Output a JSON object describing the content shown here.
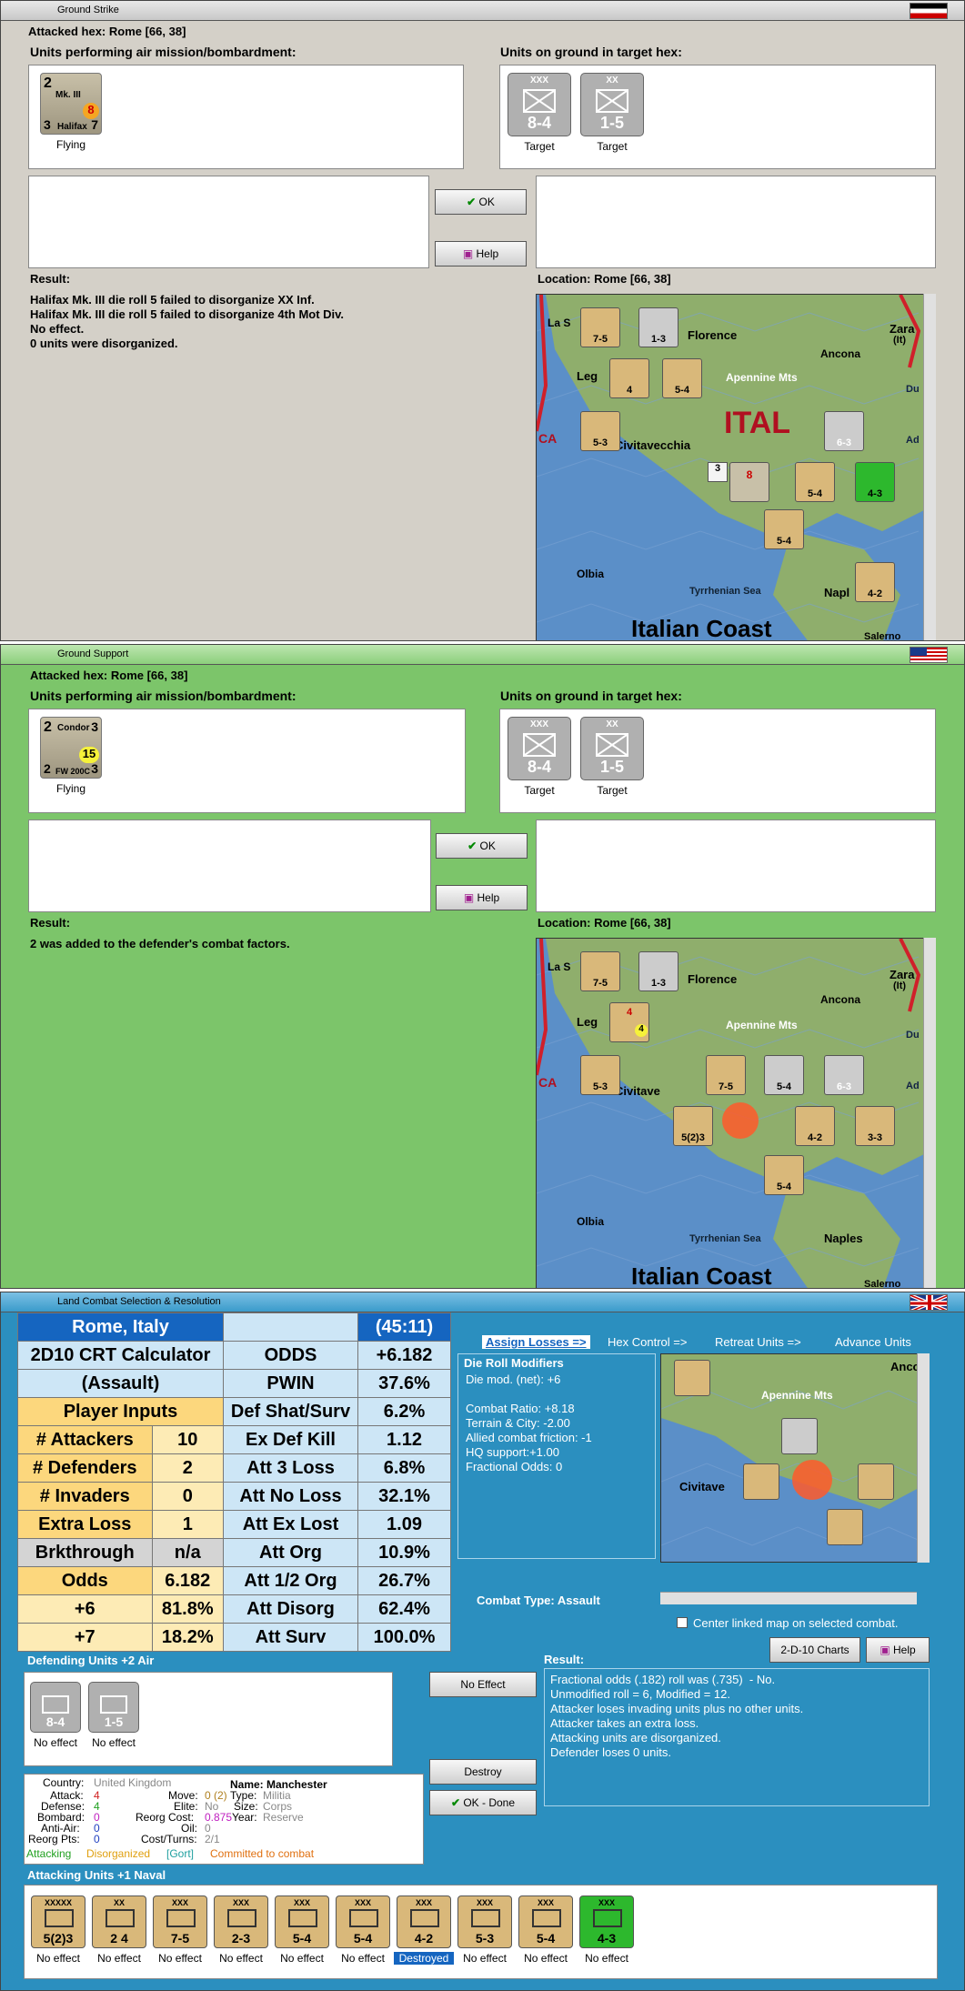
{
  "win1": {
    "title": "Ground Strike",
    "attacked": "Attacked hex: Rome  [66, 38]",
    "air_label": "Units performing air mission/bombardment:",
    "ground_label": "Units on ground in target hex:",
    "air_unit": {
      "top_left": "2",
      "top_right": "8",
      "name": "Mk. III",
      "sub": "Halifax",
      "bl": "3",
      "br": "7",
      "caption": "Flying"
    },
    "targets": [
      {
        "type": "XXX",
        "name": "XX Inf",
        "value": "8-4",
        "caption": "Target"
      },
      {
        "type": "XX",
        "name": "4th Mot Div",
        "value": "1-5",
        "caption": "Target"
      }
    ],
    "ok": "OK",
    "help": "Help",
    "result_label": "Result:",
    "location": "Location:  Rome  [66, 38]",
    "result": "Halifax Mk. III die roll 5 failed to disorganize XX Inf.\nHalifax Mk. III die roll 5 failed to disorganize 4th Mot Div.\nNo effect.\n0 units were disorganized.",
    "map_labels": [
      "La S",
      "Florence",
      "Ancona",
      "Zara",
      "(It)",
      "Leg",
      "Apennine Mts",
      "ITAL",
      "CA",
      "Civitavecchia",
      "Olbia",
      "Tyrrhenian Sea",
      "Napl",
      "Salerno",
      "Italian Coast",
      "Du",
      "Ad"
    ],
    "map_counters": [
      "7-5",
      "1-3",
      "4",
      "5-4",
      "5-3",
      "6-3",
      "5-4",
      "4-3",
      "5-4",
      "4-2",
      "8",
      "3"
    ]
  },
  "win2": {
    "title": "Ground Support",
    "attacked": "Attacked hex: Rome  [66, 38]",
    "air_label": "Units performing air mission/bombardment:",
    "ground_label": "Units on ground in target hex:",
    "air_unit": {
      "top_left": "2",
      "top_right": "3",
      "name": "Condor",
      "value": "15",
      "sub": "FW 200C",
      "bl": "2",
      "br": "3",
      "caption": "Flying"
    },
    "targets": [
      {
        "type": "XXX",
        "name": "XX Inf",
        "value": "8-4",
        "caption": "Target"
      },
      {
        "type": "XX",
        "name": "4th Mot Div",
        "value": "1-5",
        "caption": "Target"
      }
    ],
    "ok": "OK",
    "help": "Help",
    "result_label": "Result:",
    "location": "Location:  Rome  [66, 38]",
    "result": "2 was added to the defender's combat factors.",
    "map_labels": [
      "La S",
      "Florence",
      "Ancona",
      "Zara",
      "(It)",
      "Leg",
      "Apennine Mts",
      "CA",
      "Civitave",
      "Olbia",
      "Tyrrhenian Sea",
      "Naples",
      "Salerno",
      "Italian Coast",
      "Du",
      "Ad"
    ],
    "map_counters": [
      "7-5",
      "1-3",
      "5-3",
      "7-5",
      "5-4",
      "6-3",
      "5(2)3",
      "4-2",
      "3-3",
      "5-4",
      "4",
      "4"
    ]
  },
  "win3": {
    "title": "Land Combat Selection & Resolution",
    "crt": {
      "location": "Rome, Italy",
      "time": "(45:11)",
      "calc1": "2D10 CRT Calculator",
      "calc2": "(Assault)",
      "player_inputs": "Player Inputs",
      "rows": [
        {
          "l": "ODDS",
          "r": "+6.182"
        },
        {
          "l": "PWIN",
          "r": "37.6%"
        },
        {
          "l": "Def Shat/Surv",
          "r": "6.2%"
        },
        {
          "l": "Ex Def Kill",
          "r": "1.12"
        },
        {
          "l": "Att 3 Loss",
          "r": "6.8%"
        },
        {
          "l": "Att No Loss",
          "r": "32.1%"
        },
        {
          "l": "Att Ex Lost",
          "r": "1.09"
        },
        {
          "l": "Att Org",
          "r": "10.9%"
        },
        {
          "l": "Att 1/2 Org",
          "r": "26.7%"
        },
        {
          "l": "Att Disorg",
          "r": "62.4%"
        },
        {
          "l": "Att Surv",
          "r": "100.0%"
        }
      ],
      "inputs": [
        {
          "k": "# Attackers",
          "v": "10"
        },
        {
          "k": "# Defenders",
          "v": "2"
        },
        {
          "k": "# Invaders",
          "v": "0"
        },
        {
          "k": "Extra Loss",
          "v": "1"
        },
        {
          "k": "Brkthrough",
          "v": "n/a"
        },
        {
          "k": "Odds",
          "v": "6.182"
        },
        {
          "k": "+6",
          "v": "81.8%"
        },
        {
          "k": "+7",
          "v": "18.2%"
        }
      ]
    },
    "tabs": [
      "Assign Losses =>",
      "Hex Control =>",
      "Retreat Units =>",
      "Advance Units"
    ],
    "die_title": "Die Roll Modifiers",
    "die_text": "Die mod. (net): +6\n\nCombat Ratio: +8.18\nTerrain & City: -2.00\nAllied combat friction: -1\nHQ support:+1.00\nFractional Odds: 0",
    "combat_type": "Combat Type:  Assault",
    "center_link": "Center linked map on selected combat.",
    "charts_btn": "2-D-10 Charts",
    "help_btn": "Help",
    "defending_label": "Defending Units +2 Air",
    "defenders": [
      {
        "value": "8-4",
        "name": "XX Inf",
        "caption": "No effect"
      },
      {
        "value": "1-5",
        "name": "4th Mot Div",
        "caption": "No effect"
      }
    ],
    "no_effect_btn": "No Effect",
    "destroy_btn": "Destroy",
    "ok_done_btn": "OK - Done",
    "result_label": "Result:",
    "result_text": "Fractional odds (.182) roll was (.735)  - No.\nUnmodified roll = 6, Modified = 12.\nAttacker loses invading units plus no other units.\nAttacker takes an extra loss.\nAttacking units are disorganized.\nDefender loses 0 units.",
    "unit_info": {
      "country_k": "Country:",
      "country": "United Kingdom",
      "name_k": "Name:",
      "name": "Manchester",
      "attack_k": "Attack:",
      "attack": "4",
      "defense_k": "Defense:",
      "defense": "4",
      "bombard_k": "Bombard:",
      "bombard": "0",
      "antiair_k": "Anti-Air:",
      "antiair": "0",
      "reorg_k": "Reorg Pts:",
      "reorg": "0",
      "move_k": "Move:",
      "move": "0 (2)",
      "elite_k": "Elite:",
      "elite": "No",
      "rcost_k": "Reorg Cost:",
      "rcost": "0.875",
      "oil_k": "Oil:",
      "oil": "0",
      "cost_k": "Cost/Turns:",
      "cost": "2/1",
      "type_k": "Type:",
      "type": "Militia",
      "size_k": "Size:",
      "size": "Corps",
      "year_k": "Year:",
      "year": "Reserve",
      "status1": "Attacking",
      "status2": "Disorganized",
      "status3": "[Gort]",
      "status4": "Committed to combat"
    },
    "attacking_label": "Attacking Units +1 Naval",
    "attackers": [
      {
        "type": "XXXXX",
        "value": "5(2)3",
        "caption": "No effect",
        "color": "#d9b87a"
      },
      {
        "type": "XX",
        "value": "2 4",
        "caption": "No effect",
        "color": "#d9b87a"
      },
      {
        "type": "XXX",
        "value": "7-5",
        "caption": "No effect",
        "color": "#d9b87a"
      },
      {
        "type": "XXX",
        "value": "2-3",
        "caption": "No effect",
        "color": "#d9b87a"
      },
      {
        "type": "XXX",
        "value": "5-4",
        "caption": "No effect",
        "color": "#d9b87a"
      },
      {
        "type": "XXX",
        "value": "5-4",
        "caption": "No effect",
        "color": "#d9b87a"
      },
      {
        "type": "XXX",
        "value": "4-2",
        "caption": "Destroyed",
        "color": "#d9b87a"
      },
      {
        "type": "XXX",
        "value": "5-3",
        "caption": "No effect",
        "color": "#d9b87a"
      },
      {
        "type": "XXX",
        "value": "5-4",
        "caption": "No effect",
        "color": "#d9b87a"
      },
      {
        "type": "XXX",
        "value": "4-3",
        "caption": "No effect",
        "color": "#2db82d"
      }
    ],
    "map_labels": [
      "Anco",
      "Apennine Mts",
      "Civitave"
    ]
  },
  "colors": {
    "grey_bg": "#d4d0c8",
    "green_bg": "#7cc56a",
    "teal_bg": "#2b8fbf",
    "title_blue": "#1565c0"
  }
}
